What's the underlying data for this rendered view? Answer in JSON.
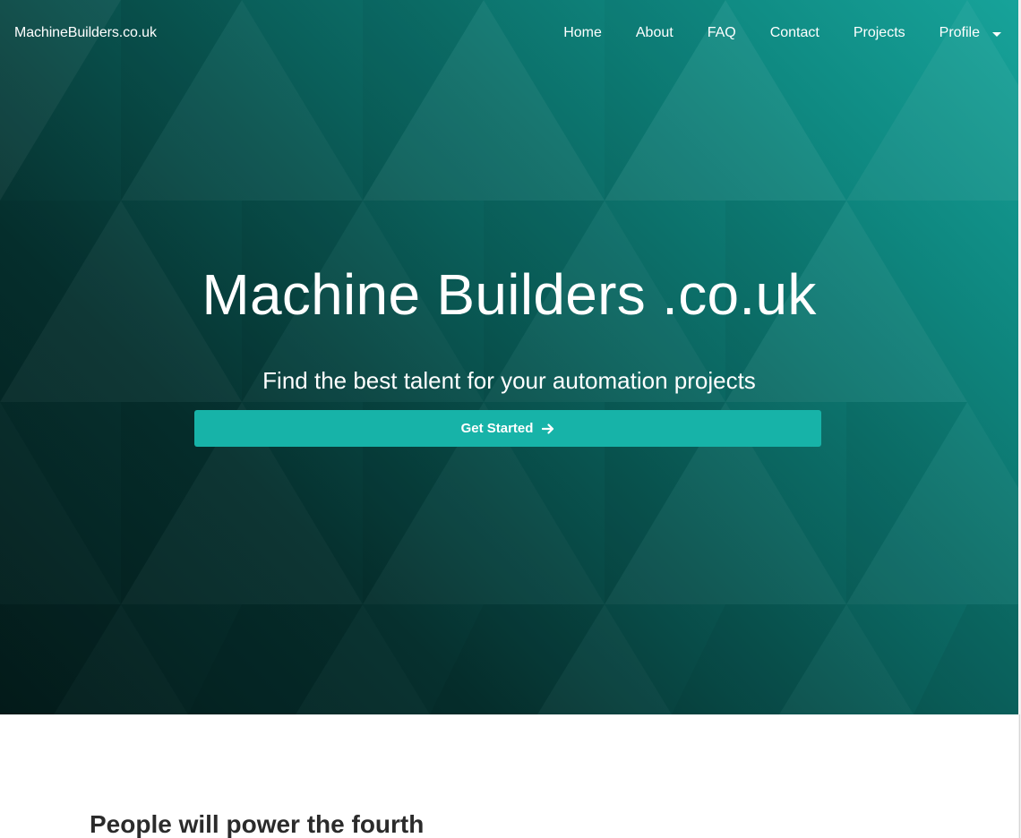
{
  "navbar": {
    "brand": "MachineBuilders.co.uk",
    "links": [
      "Home",
      "About",
      "FAQ",
      "Contact",
      "Projects"
    ],
    "profile_label": "Profile",
    "profile_icon": "caret-down-icon"
  },
  "hero": {
    "title": "Machine Builders .co.uk",
    "subtitle": "Find the best talent for your automation projects",
    "cta_label": "Get Started",
    "cta_icon": "arrow-right-icon",
    "colors": {
      "gradient_light": "#17a39a",
      "gradient_dark": "#041c1b",
      "button": "#17b3a8"
    }
  },
  "section": {
    "heading": "People will power the fourth"
  }
}
